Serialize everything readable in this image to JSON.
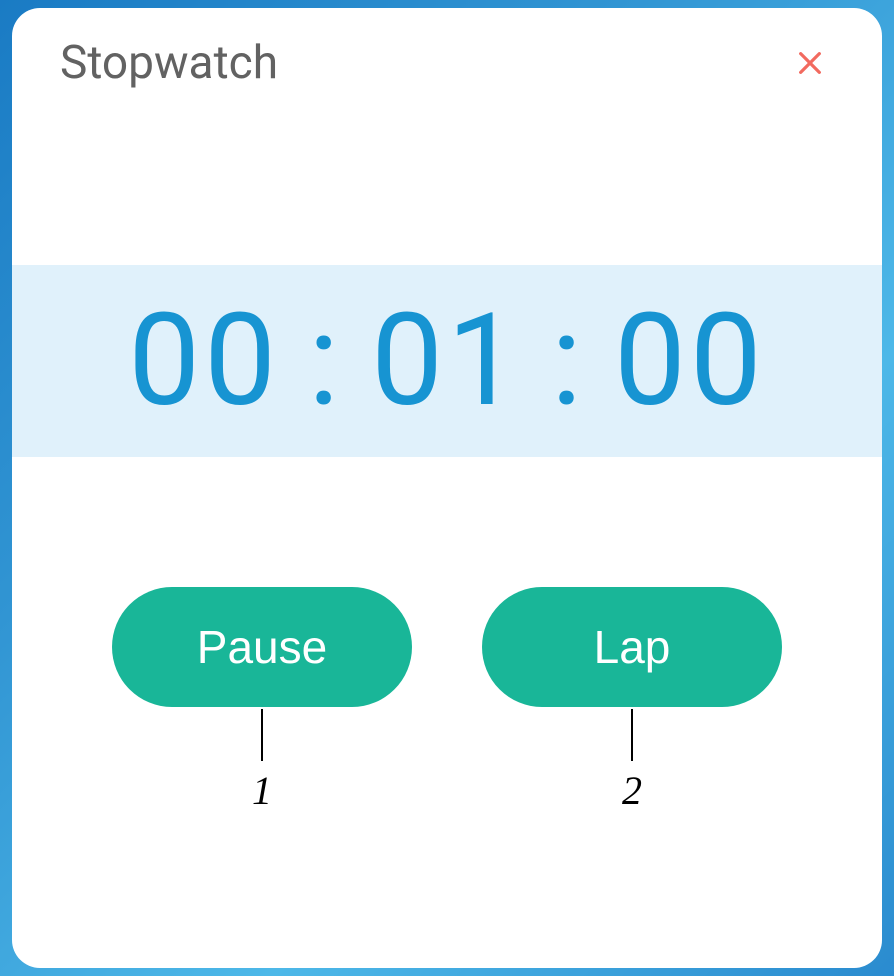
{
  "header": {
    "title": "Stopwatch"
  },
  "time": {
    "hours": "00",
    "sep1": ":",
    "minutes": "01",
    "sep2": ":",
    "seconds": "00"
  },
  "buttons": {
    "pause": {
      "label": "Pause",
      "callout": "1"
    },
    "lap": {
      "label": "Lap",
      "callout": "2"
    }
  }
}
